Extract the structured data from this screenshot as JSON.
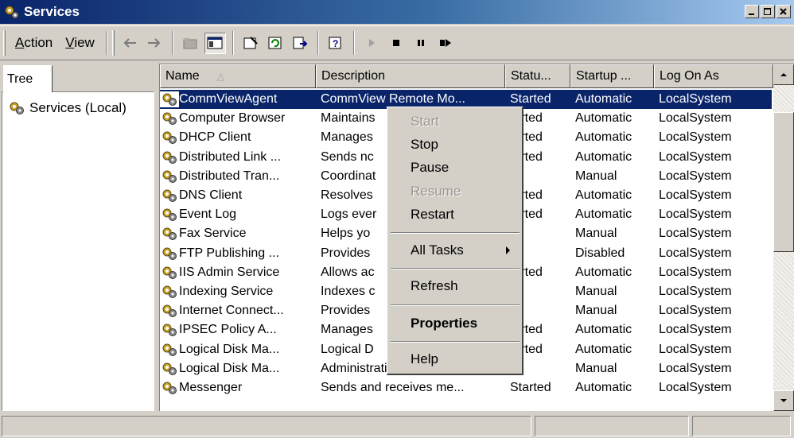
{
  "window": {
    "title": "Services",
    "icon": "gears-icon"
  },
  "menu": {
    "action": "Action",
    "action_key": "A",
    "view": "View",
    "view_key": "V"
  },
  "tree": {
    "tab_label": "Tree",
    "root": "Services (Local)"
  },
  "columns": {
    "name": "Name",
    "description": "Description",
    "status": "Statu...",
    "startup": "Startup ...",
    "logon": "Log On As"
  },
  "services": [
    {
      "name": "CommViewAgent",
      "description": "CommView Remote Mo...",
      "status": "Started",
      "startup": "Automatic",
      "logon": "LocalSystem",
      "selected": true
    },
    {
      "name": "Computer Browser",
      "description": "Maintains",
      "status": "tarted",
      "startup": "Automatic",
      "logon": "LocalSystem"
    },
    {
      "name": "DHCP Client",
      "description": "Manages",
      "status": "tarted",
      "startup": "Automatic",
      "logon": "LocalSystem"
    },
    {
      "name": "Distributed Link ...",
      "description": "Sends nc",
      "status": "tarted",
      "startup": "Automatic",
      "logon": "LocalSystem"
    },
    {
      "name": "Distributed Tran...",
      "description": "Coordinat",
      "status": "",
      "startup": "Manual",
      "logon": "LocalSystem"
    },
    {
      "name": "DNS Client",
      "description": "Resolves",
      "status": "tarted",
      "startup": "Automatic",
      "logon": "LocalSystem"
    },
    {
      "name": "Event Log",
      "description": "Logs ever",
      "status": "tarted",
      "startup": "Automatic",
      "logon": "LocalSystem"
    },
    {
      "name": "Fax Service",
      "description": "Helps yo",
      "status": "",
      "startup": "Manual",
      "logon": "LocalSystem"
    },
    {
      "name": "FTP Publishing ...",
      "description": "Provides",
      "status": "",
      "startup": "Disabled",
      "logon": "LocalSystem"
    },
    {
      "name": "IIS Admin Service",
      "description": "Allows ac",
      "status": "tarted",
      "startup": "Automatic",
      "logon": "LocalSystem"
    },
    {
      "name": "Indexing Service",
      "description": "Indexes c",
      "status": "",
      "startup": "Manual",
      "logon": "LocalSystem"
    },
    {
      "name": "Internet Connect...",
      "description": "Provides",
      "status": "",
      "startup": "Manual",
      "logon": "LocalSystem"
    },
    {
      "name": "IPSEC Policy A...",
      "description": "Manages",
      "status": "tarted",
      "startup": "Automatic",
      "logon": "LocalSystem"
    },
    {
      "name": "Logical Disk Ma...",
      "description": "Logical D",
      "status": "tarted",
      "startup": "Automatic",
      "logon": "LocalSystem"
    },
    {
      "name": "Logical Disk Ma...",
      "description": "Administrative service f...",
      "status": "",
      "startup": "Manual",
      "logon": "LocalSystem"
    },
    {
      "name": "Messenger",
      "description": "Sends and receives me...",
      "status": "Started",
      "startup": "Automatic",
      "logon": "LocalSystem"
    }
  ],
  "context_menu": {
    "start": "Start",
    "stop": "Stop",
    "pause": "Pause",
    "resume": "Resume",
    "restart": "Restart",
    "all_tasks": "All Tasks",
    "refresh": "Refresh",
    "properties": "Properties",
    "help": "Help"
  },
  "colors": {
    "selection": "#0a246a",
    "title_start": "#0a246a",
    "title_end": "#a6caf0",
    "face": "#d4d0c8"
  }
}
